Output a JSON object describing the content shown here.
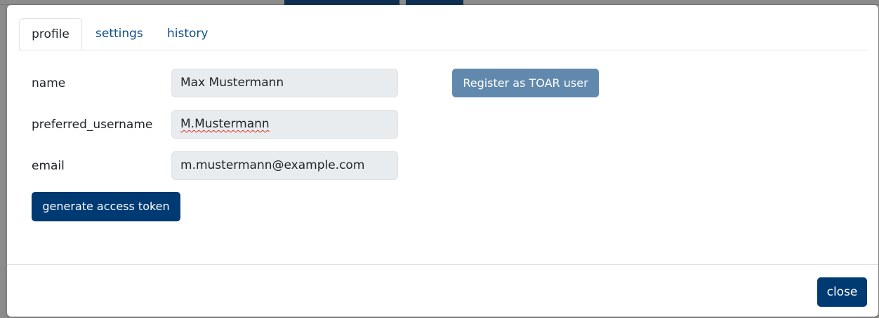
{
  "tabs": {
    "profile": "profile",
    "settings": "settings",
    "history": "history"
  },
  "form": {
    "name_label": "name",
    "name_value": "Max Mustermann",
    "username_label": "preferred_username",
    "username_value": "M.Mustermann",
    "email_label": "email",
    "email_value": "m.mustermann@example.com"
  },
  "buttons": {
    "register": "Register as TOAR user",
    "generate_token": "generate access token",
    "close": "close"
  },
  "colors": {
    "primary": "#003a73",
    "register_button": "#6189ad",
    "tab_link": "#0d4f8b",
    "field_background": "#e9ecef"
  }
}
